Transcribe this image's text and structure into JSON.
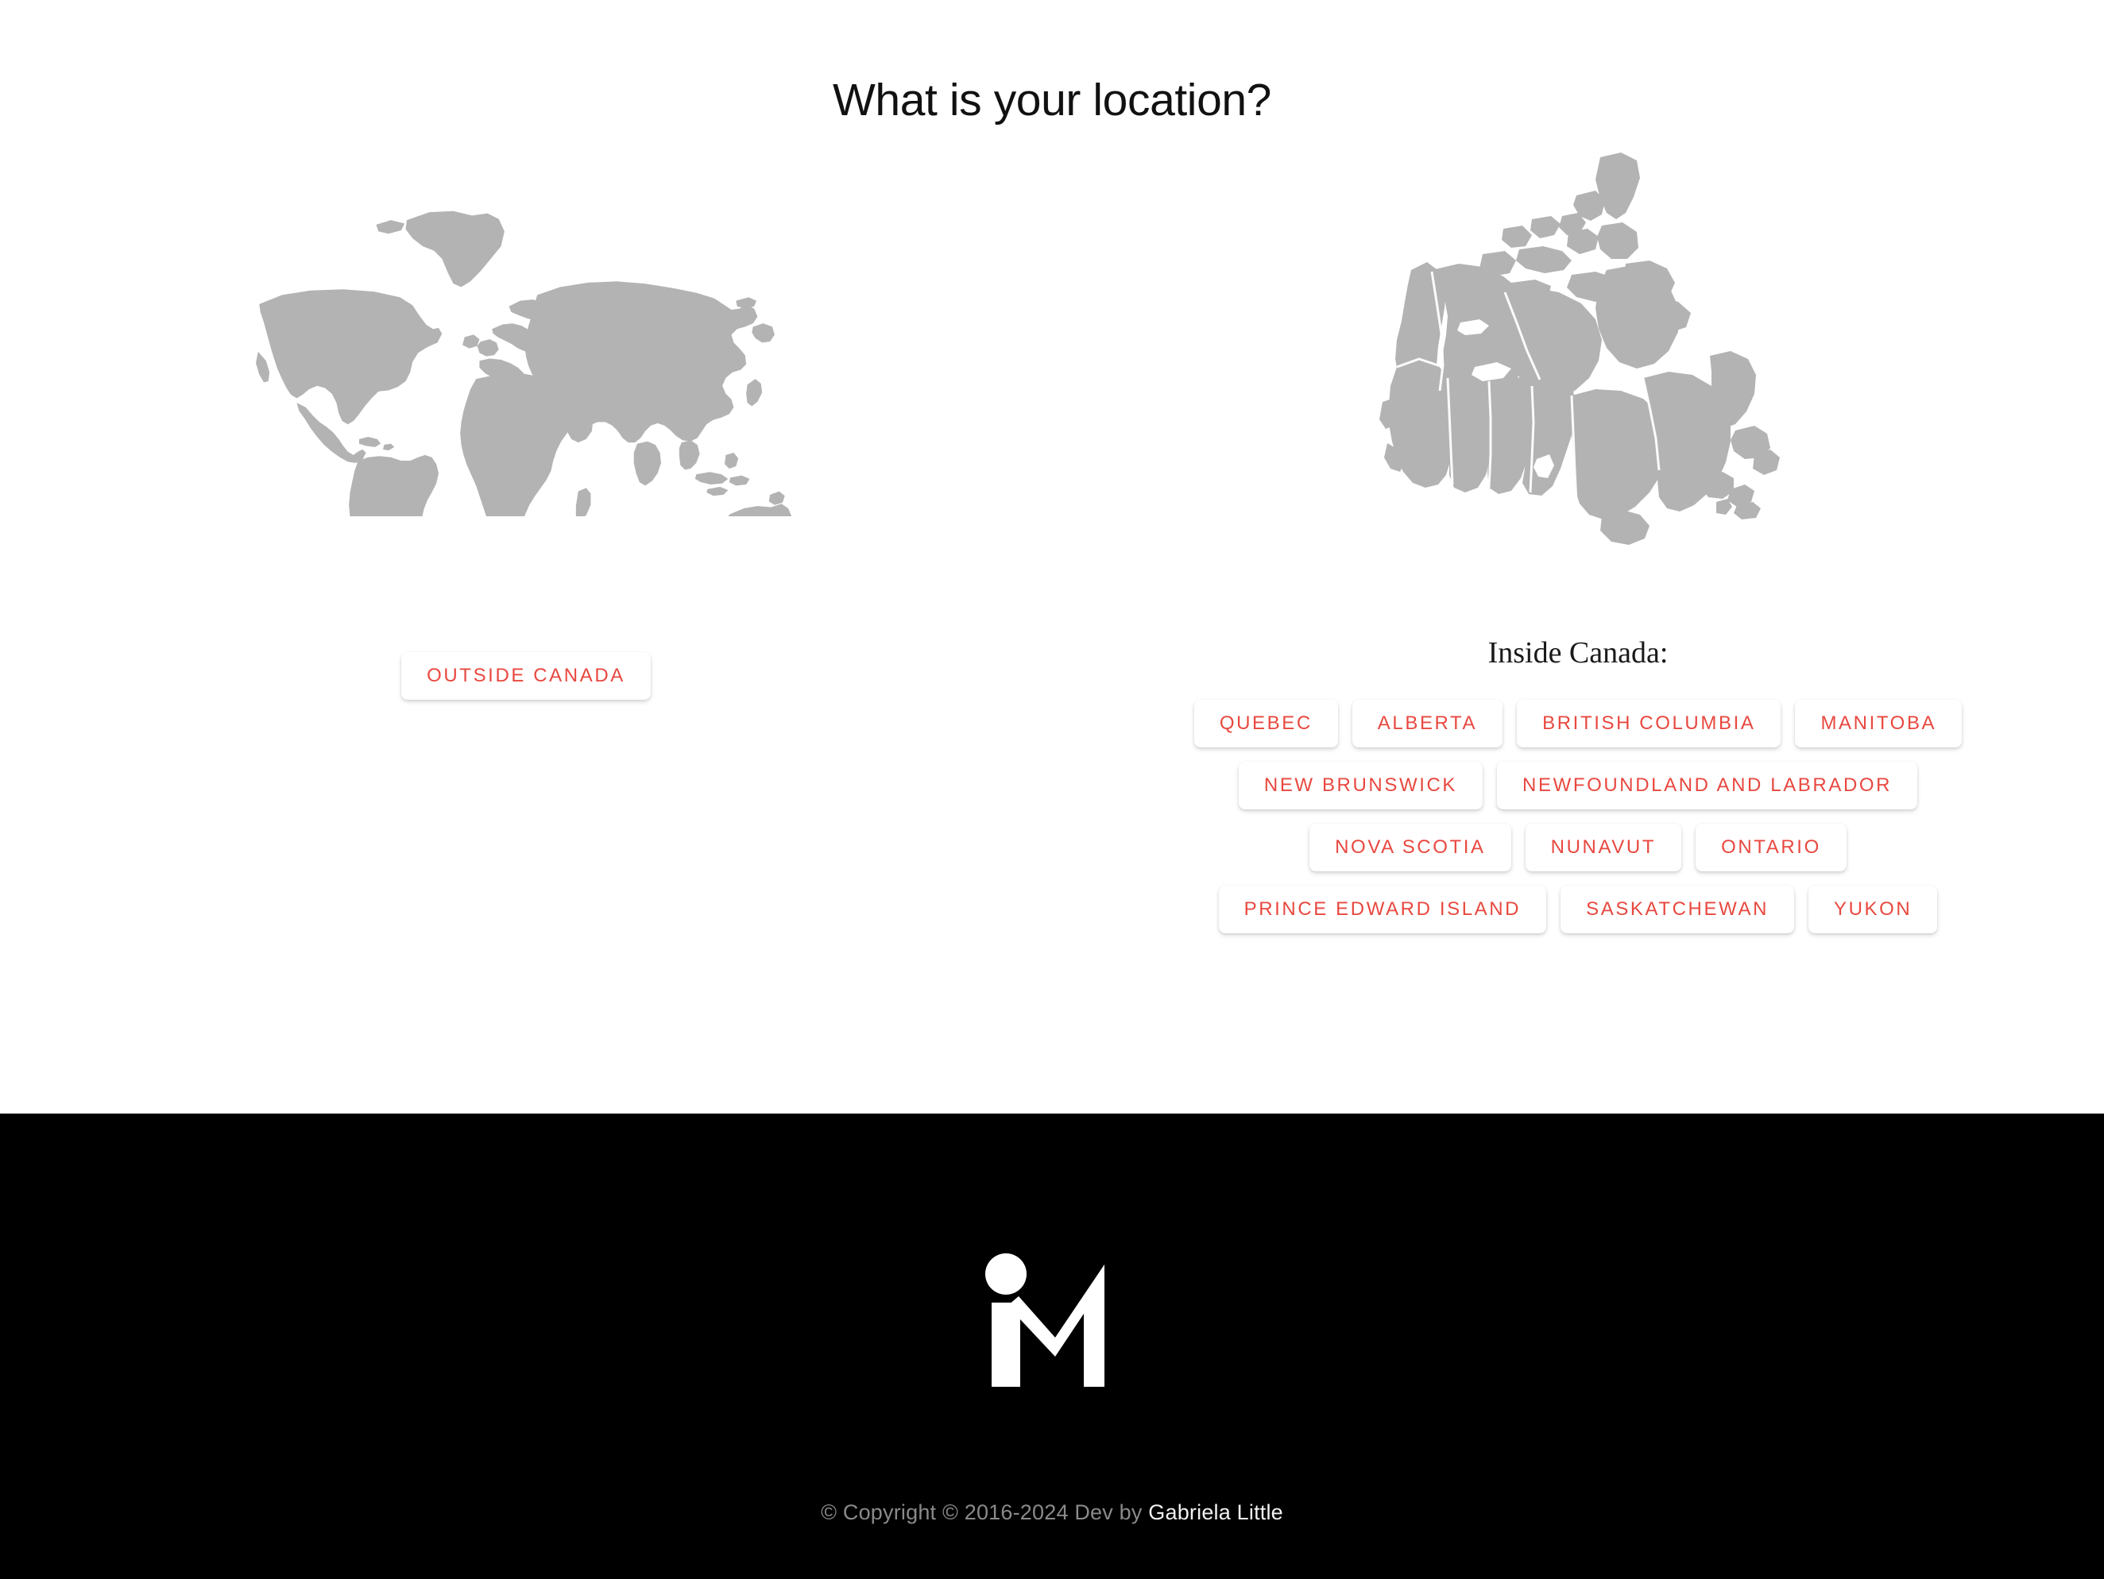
{
  "page": {
    "title": "What is your location?",
    "background": "#ffffff",
    "accent_red": "#e8483f",
    "map_gray": "#b3b3b3"
  },
  "outside": {
    "map_icon": "world-map",
    "button_label": "Outside Canada"
  },
  "inside": {
    "map_icon": "canada-map",
    "heading": "Inside Canada:",
    "provinces": [
      "Quebec",
      "Alberta",
      "British Columbia",
      "Manitoba",
      "New Brunswick",
      "Newfoundland and Labrador",
      "Nova Scotia",
      "Nunavut",
      "Ontario",
      "Prince Edward Island",
      "Saskatchewan",
      "Yukon"
    ]
  },
  "footer": {
    "logo_icon": "im-monogram-logo",
    "copyright": "© Copyright © 2016-2024 Dev by ",
    "author": "Gabriela Little",
    "background": "#000000"
  }
}
